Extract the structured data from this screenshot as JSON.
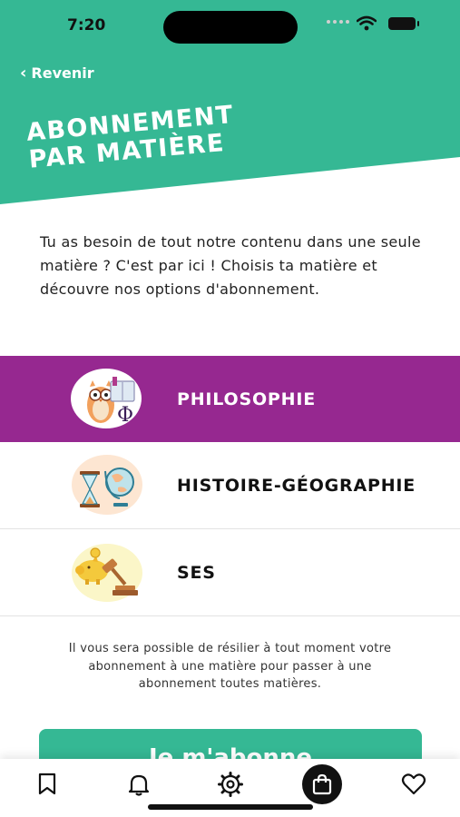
{
  "status_bar": {
    "time": "7:20"
  },
  "header": {
    "back_label": "Revenir",
    "title_line1": "ABONNEMENT",
    "title_line2": "PAR MATIÈRE",
    "color": "#35b894"
  },
  "intro_text": "Tu as besoin de tout notre contenu dans une seule matière ? C'est par ici ! Choisis ta matière et découvre nos options d'abonnement.",
  "subjects": [
    {
      "label": "PHILOSOPHIE",
      "icon": "owl-book-phi-icon",
      "selected": true
    },
    {
      "label": "HISTOIRE-GÉOGRAPHIE",
      "icon": "hourglass-globe-icon",
      "selected": false
    },
    {
      "label": "SES",
      "icon": "piggy-bank-gavel-icon",
      "selected": false
    }
  ],
  "selected_color": "#962890",
  "note_text": "Il vous sera possible de résilier à tout moment votre abonnement à une matière pour passer à une abonnement toutes matières.",
  "cta_label": "Je m'abonne",
  "tabbar": {
    "tabs": [
      {
        "icon": "bookmark-icon"
      },
      {
        "icon": "bell-icon"
      },
      {
        "icon": "gear-icon"
      },
      {
        "icon": "shopping-bag-icon",
        "active": true
      },
      {
        "icon": "heart-icon"
      }
    ]
  }
}
